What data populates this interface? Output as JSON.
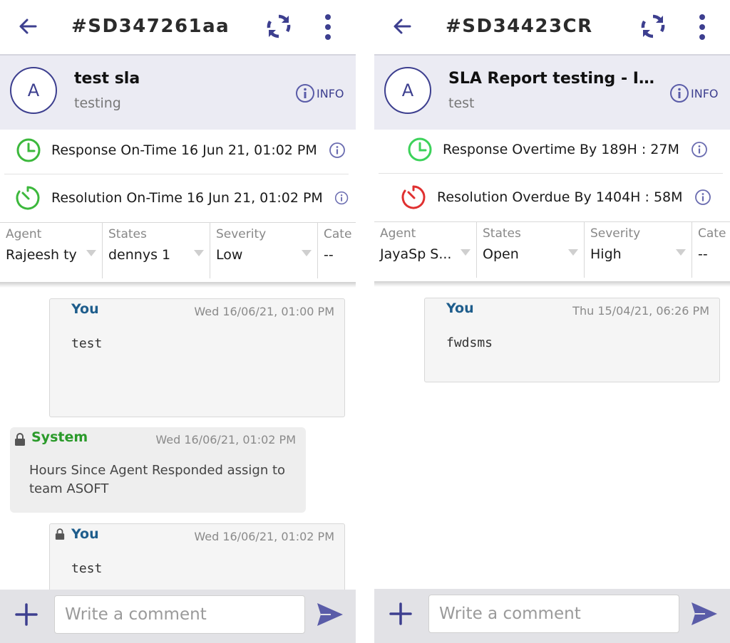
{
  "screens": [
    {
      "ticket_id": "#SD347261aa",
      "avatar_initial": "A",
      "title": "test sla",
      "subtitle": "testing",
      "info_label": "INFO",
      "sla": [
        {
          "text": "Response On-Time 16 Jun 21, 01:02 PM",
          "status": "on-time",
          "icon": "clock-icon",
          "color": "#3cb83c"
        },
        {
          "text": "Resolution On-Time 16 Jun 21, 01:02 PM",
          "status": "on-time",
          "icon": "timer-icon",
          "color": "#3cb83c"
        }
      ],
      "filters": [
        {
          "label": "Agent",
          "value": "Rajeesh ty"
        },
        {
          "label": "States",
          "value": "dennys 1"
        },
        {
          "label": "Severity",
          "value": "Low"
        },
        {
          "label": "Cate",
          "value": "--"
        }
      ],
      "messages": [
        {
          "author": "You",
          "time": "Wed 16/06/21, 01:00 PM",
          "body": "test",
          "type": "agent",
          "locked": false
        },
        {
          "author": "System",
          "time": "Wed 16/06/21, 01:02 PM",
          "body": "Hours Since Agent Responded assign to team ASOFT",
          "type": "system",
          "locked": true
        },
        {
          "author": "You",
          "time": "Wed 16/06/21, 01:02 PM",
          "body": "test",
          "type": "agent",
          "locked": true
        }
      ],
      "composer_placeholder": "Write a comment"
    },
    {
      "ticket_id": "#SD34423CR",
      "avatar_initial": "A",
      "title": "SLA Report testing - In Da...",
      "subtitle": "test",
      "info_label": "INFO",
      "sla": [
        {
          "text": "Response Overtime By 189H : 27M",
          "status": "overtime",
          "icon": "clock-icon",
          "color": "#3cd25a"
        },
        {
          "text": "Resolution Overdue By 1404H : 58M",
          "status": "overdue",
          "icon": "timer-icon",
          "color": "#e03030"
        }
      ],
      "filters": [
        {
          "label": "Agent",
          "value": "JayaSp S..."
        },
        {
          "label": "States",
          "value": "Open"
        },
        {
          "label": "Severity",
          "value": "High"
        },
        {
          "label": "Cate",
          "value": "--"
        }
      ],
      "messages": [
        {
          "author": "You",
          "time": "Thu 15/04/21, 06:26 PM",
          "body": "fwdsms",
          "type": "agent",
          "locked": false
        }
      ],
      "composer_placeholder": "Write a comment"
    }
  ],
  "theme": {
    "accent": "#3d3f8f",
    "header_bg": "#ebebf3",
    "author_you": "#1e5d8c",
    "author_system": "#2a9a2a",
    "info_icon": "#6a6cb0"
  }
}
